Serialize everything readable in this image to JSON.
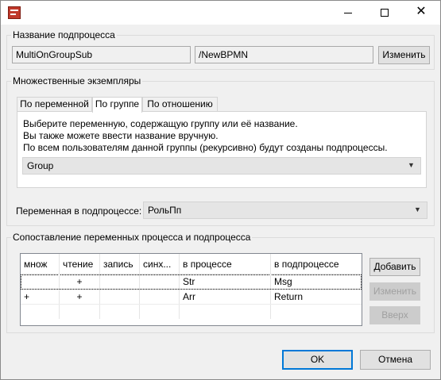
{
  "titlebar": {
    "icon": "bpmn-app-icon",
    "minimize_icon": "minimize-icon",
    "maximize_icon": "maximize-icon",
    "close_icon": "close-icon",
    "close_glyph": "✕"
  },
  "subprocess": {
    "group_title": "Название подпроцесса",
    "name_value": "MultiOnGroupSub",
    "path_value": "/NewBPMN",
    "change_label": "Изменить"
  },
  "multi_instance": {
    "group_title": "Множественные экземпляры",
    "tabs": [
      {
        "label": "По переменной"
      },
      {
        "label": "По группе"
      },
      {
        "label": "По отношению"
      }
    ],
    "active_tab": "По группе",
    "description": [
      "Выберите переменную, содержащую группу или её название.",
      "Вы также можете ввести название вручную.",
      "По всем пользователям данной группы (рекурсивно) будут созданы подпроцессы."
    ],
    "group_select": {
      "value": "Group"
    }
  },
  "subprocess_variable": {
    "label": "Переменная в подпроцессе:",
    "value": "РольПп"
  },
  "mapping": {
    "group_title": "Сопоставление переменных процесса и подпроцесса",
    "columns": [
      "множ",
      "чтение",
      "запись",
      "синх...",
      "в процессе",
      "в подпроцессе"
    ],
    "rows": [
      {
        "mult": "",
        "read": "+",
        "write": "",
        "sync": "",
        "process_var": "Str",
        "subprocess_var": "Msg"
      },
      {
        "mult": "+",
        "read": "+",
        "write": "",
        "sync": "",
        "process_var": "Arr",
        "subprocess_var": "Return"
      }
    ],
    "add_label": "Добавить",
    "edit_label": "Изменить",
    "up_label": "Вверх"
  },
  "footer": {
    "ok_label": "OK",
    "cancel_label": "Отмена"
  },
  "colors": {
    "default_button_border": "#0078d7",
    "disabled_text": "#a0a0a0"
  }
}
